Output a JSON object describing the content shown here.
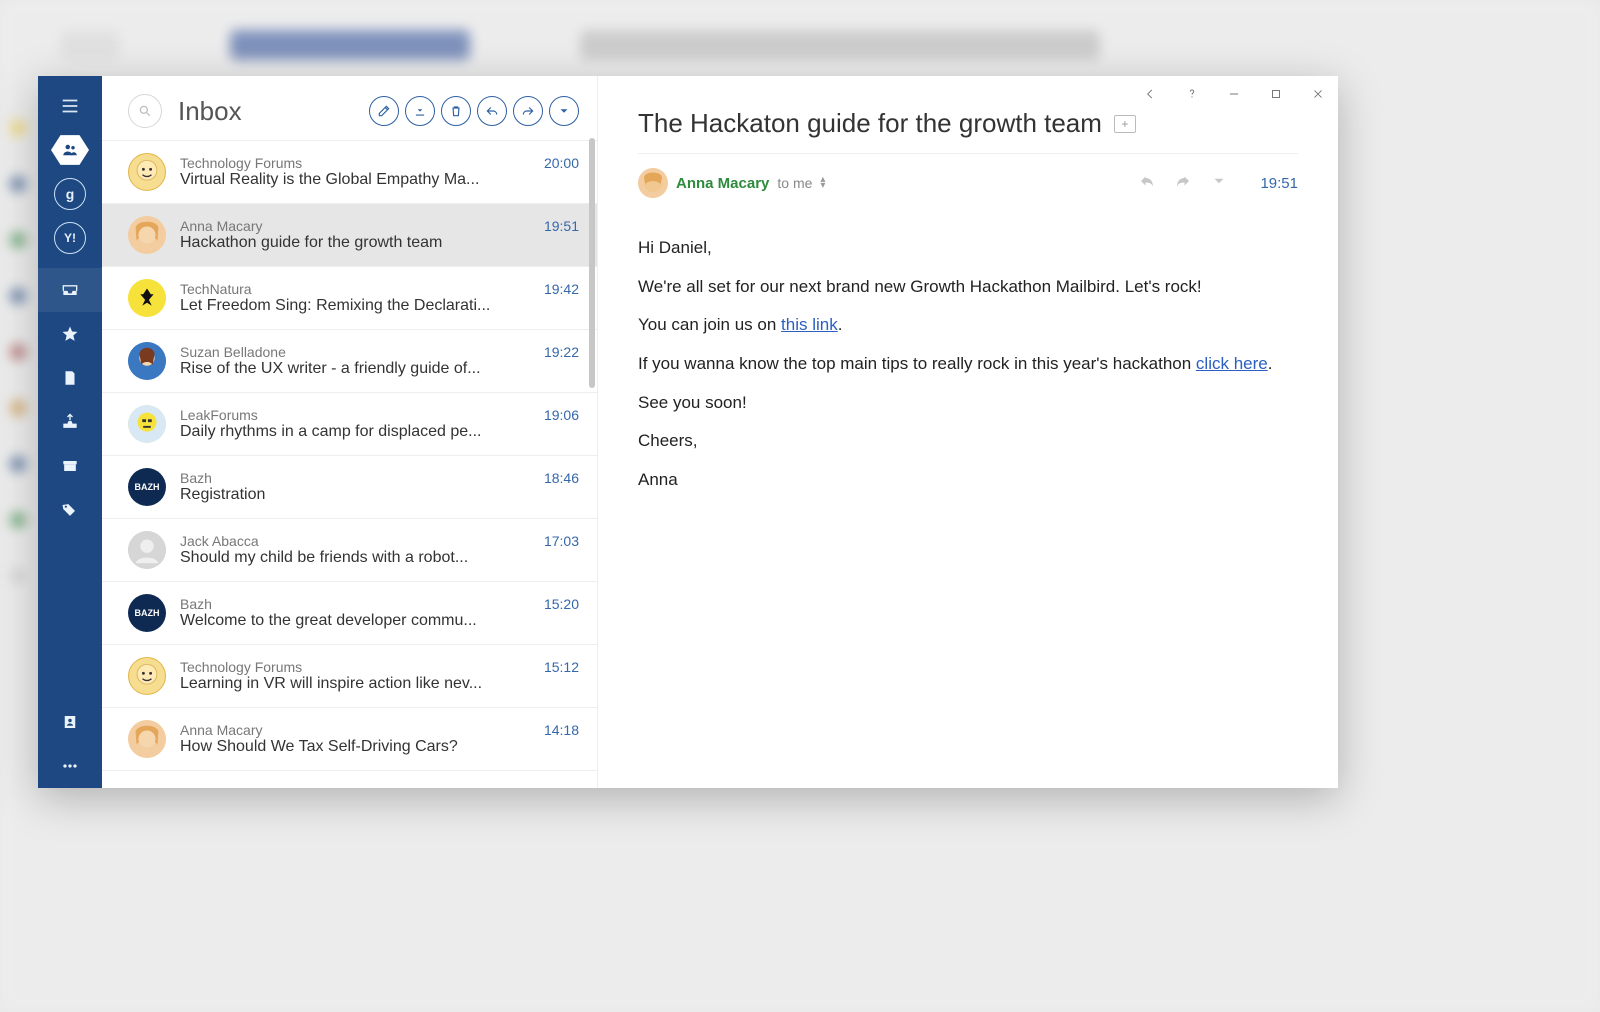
{
  "sidebar": {
    "accounts": [
      {
        "name": "contacts",
        "icon": "people"
      },
      {
        "name": "google",
        "label": "g"
      },
      {
        "name": "yahoo",
        "label": "Y!"
      }
    ],
    "folders": [
      {
        "name": "inbox",
        "icon": "inbox",
        "active": true
      },
      {
        "name": "starred",
        "icon": "star"
      },
      {
        "name": "notes",
        "icon": "note"
      },
      {
        "name": "sent",
        "icon": "outbox"
      },
      {
        "name": "archive",
        "icon": "archive"
      },
      {
        "name": "tags",
        "icon": "tags"
      }
    ],
    "bottom": [
      {
        "name": "addressbook",
        "icon": "book"
      },
      {
        "name": "more",
        "icon": "dots"
      }
    ]
  },
  "list": {
    "title": "Inbox",
    "toolbar": [
      "compose",
      "download",
      "delete",
      "reply",
      "forward",
      "more"
    ],
    "items": [
      {
        "sender": "Technology Forums",
        "subject": "Virtual Reality is the Global Empathy Ma...",
        "time": "20:00",
        "avatar": "tf"
      },
      {
        "sender": "Anna Macary",
        "subject": "Hackathon guide for the growth team",
        "time": "19:51",
        "avatar": "am",
        "selected": true
      },
      {
        "sender": "TechNatura",
        "subject": "Let Freedom Sing: Remixing the Declarati...",
        "time": "19:42",
        "avatar": "tn"
      },
      {
        "sender": "Suzan Belladone",
        "subject": "Rise of the UX writer - a friendly guide of...",
        "time": "19:22",
        "avatar": "sb"
      },
      {
        "sender": "LeakForums",
        "subject": "Daily rhythms in a camp for displaced pe...",
        "time": "19:06",
        "avatar": "lf"
      },
      {
        "sender": "Bazh",
        "subject": "Registration",
        "time": "18:46",
        "avatar": "bazh",
        "avatarLabel": "BAZH"
      },
      {
        "sender": "Jack Abacca",
        "subject": "Should my child be friends with a robot...",
        "time": "17:03",
        "avatar": "ja"
      },
      {
        "sender": "Bazh",
        "subject": "Welcome to the great developer commu...",
        "time": "15:20",
        "avatar": "bazh",
        "avatarLabel": "BAZH"
      },
      {
        "sender": "Technology Forums",
        "subject": "Learning in VR will inspire action like nev...",
        "time": "15:12",
        "avatar": "tf"
      },
      {
        "sender": "Anna Macary",
        "subject": "How Should We Tax Self-Driving Cars?",
        "time": "14:18",
        "avatar": "am"
      }
    ]
  },
  "content": {
    "subject": "The Hackaton guide for the growth team",
    "senderName": "Anna Macary",
    "toLabel": "to me",
    "time": "19:51",
    "body": {
      "p1": "Hi Daniel,",
      "p2": "We're all set for our next brand new Growth Hackathon Mailbird. Let's rock!",
      "p3_a": "You can join us on ",
      "p3_link": "this link",
      "p3_b": ".",
      "p4_a": "If you wanna know the top main tips to really rock in this year's hackathon ",
      "p4_link": "click here",
      "p4_b": ".",
      "p5": "See you soon!",
      "p6": "Cheers,",
      "p7": "Anna"
    }
  }
}
